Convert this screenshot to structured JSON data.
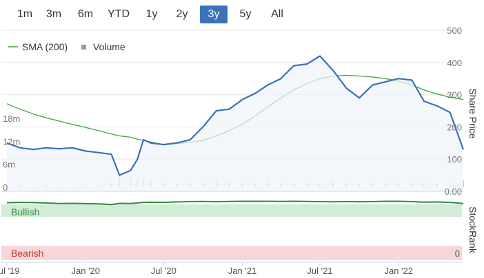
{
  "range_selector": {
    "buttons": [
      "1m",
      "3m",
      "6m",
      "YTD",
      "1y",
      "2y",
      "3y",
      "5y",
      "All"
    ],
    "active": "3y"
  },
  "colors": {
    "price_line": "#3b6fb6",
    "sma_line": "#3aa63a",
    "bullish_band": "#d3ecd8",
    "bullish_line": "#2e8b3e",
    "bearish_band": "#f6d7d9",
    "bearish_text": "#c0392b",
    "volume_bar": "#cccccc",
    "active_button": "#3b73b9"
  },
  "chart_data": {
    "type": "line",
    "x": [
      "2019-07-01",
      "2019-08-01",
      "2019-09-01",
      "2019-10-01",
      "2019-11-01",
      "2019-12-01",
      "2020-01-01",
      "2020-02-01",
      "2020-03-01",
      "2020-03-20",
      "2020-04-15",
      "2020-05-01",
      "2020-05-15",
      "2020-06-01",
      "2020-07-01",
      "2020-08-01",
      "2020-09-01",
      "2020-10-01",
      "2020-11-01",
      "2020-12-01",
      "2021-01-01",
      "2021-02-01",
      "2021-03-01",
      "2021-04-01",
      "2021-05-01",
      "2021-06-01",
      "2021-07-01",
      "2021-08-01",
      "2021-09-01",
      "2021-10-01",
      "2021-11-01",
      "2021-12-01",
      "2022-01-01",
      "2022-02-01",
      "2022-03-01",
      "2022-04-01",
      "2022-05-01",
      "2022-06-01"
    ],
    "series": [
      {
        "name": "Share Price",
        "axis": "price",
        "values": [
          150,
          135,
          130,
          135,
          132,
          135,
          125,
          120,
          115,
          50,
          65,
          100,
          160,
          150,
          145,
          150,
          160,
          200,
          250,
          255,
          285,
          305,
          330,
          350,
          390,
          395,
          420,
          375,
          320,
          290,
          330,
          340,
          350,
          345,
          280,
          265,
          245,
          130
        ]
      },
      {
        "name": "SMA (200)",
        "axis": "price",
        "values": [
          272,
          255,
          240,
          228,
          218,
          208,
          198,
          188,
          178,
          172,
          168,
          162,
          158,
          153,
          145,
          148,
          152,
          158,
          172,
          188,
          208,
          235,
          262,
          290,
          315,
          335,
          350,
          358,
          360,
          358,
          355,
          350,
          342,
          330,
          315,
          302,
          292,
          285
        ]
      }
    ],
    "volume": {
      "name": "Volume",
      "unit": "volume",
      "values": [
        0.4,
        0.5,
        0.3,
        0.6,
        0.4,
        0.5,
        0.7,
        0.6,
        1.2,
        3.5,
        2.5,
        2.0,
        1.8,
        1.5,
        1.0,
        0.9,
        1.1,
        1.3,
        1.6,
        1.4,
        1.2,
        1.0,
        1.3,
        1.1,
        0.9,
        1.2,
        1.0,
        1.4,
        1.1,
        0.9,
        1.0,
        1.2,
        1.3,
        1.0,
        1.4,
        0.9,
        1.2,
        1.8
      ]
    },
    "x_ticks": [
      "Jul '19",
      "Jan '20",
      "Jul '20",
      "Jan '21",
      "Jul '21",
      "Jan '22"
    ],
    "y_price": {
      "label": "Share Price",
      "ticks": [
        "500",
        "400",
        "300",
        "200",
        "100",
        "0.00"
      ],
      "range": [
        0,
        500
      ]
    },
    "y_volume": {
      "ticks": [
        "18m",
        "12m",
        "6m",
        "0"
      ],
      "range": [
        0,
        18
      ]
    },
    "legend": [
      {
        "label": "SMA (200)",
        "marker": "line"
      },
      {
        "label": "Volume",
        "marker": "square"
      }
    ],
    "stockrank": {
      "label": "StockRank",
      "bullish_label": "Bullish",
      "bearish_label": "Bearish",
      "zero_label": "0",
      "range": [
        0,
        100
      ],
      "values": [
        90,
        92,
        91,
        88,
        85,
        86,
        84,
        83,
        78,
        86,
        85,
        88,
        92,
        93,
        92,
        95,
        97,
        98,
        96,
        98,
        99,
        99,
        99,
        98,
        99,
        98,
        97,
        96,
        97,
        96,
        97,
        99,
        99,
        97,
        94,
        95,
        92,
        85
      ]
    }
  }
}
